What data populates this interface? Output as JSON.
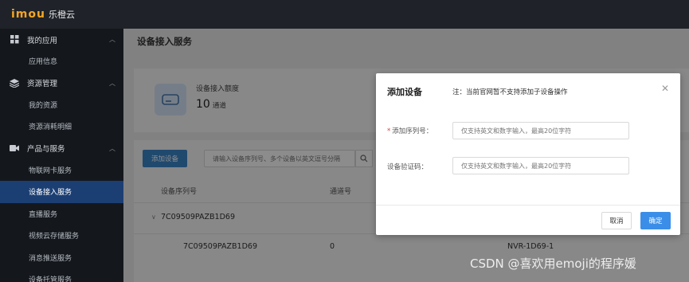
{
  "topbar": {
    "logo": "imou",
    "brand": "乐橙云"
  },
  "sidebar": {
    "groups": [
      {
        "label": "我的应用",
        "items": [
          "应用信息"
        ]
      },
      {
        "label": "资源管理",
        "items": [
          "我的资源",
          "资源消耗明细"
        ]
      },
      {
        "label": "产品与服务",
        "items": [
          "物联网卡服务",
          "设备接入服务",
          "直播服务",
          "视频云存储服务",
          "消息推送服务",
          "设备托管服务"
        ]
      }
    ],
    "active_item": "设备接入服务"
  },
  "main": {
    "title": "设备接入服务",
    "quota": {
      "label": "设备接入额度",
      "value": "10",
      "unit": "通道"
    },
    "add_button": "添加设备",
    "search_placeholder": "请输入设备序列号、多个设备以英文逗号分隔",
    "columns": [
      "设备序列号",
      "通道号"
    ],
    "rows": [
      {
        "serial": "7C09509PAZB1D69"
      },
      {
        "serial": "7C09509PAZB1D69",
        "channel": "0",
        "name": "NVR-1D69-1"
      }
    ]
  },
  "dialog": {
    "title": "添加设备",
    "note": "注：当前官网暂不支持添加子设备操作",
    "serial_label": "添加序列号：",
    "serial_placeholder": "仅支持英文和数字输入，最高20位字符",
    "code_label": "设备验证码：",
    "code_placeholder": "仅支持英文和数字输入，最高20位字符",
    "cancel": "取消",
    "confirm": "确定"
  },
  "watermark": "CSDN @喜欢用emoji的程序媛",
  "colors": {
    "accent": "#3b8ee8",
    "sidebar_bg": "#14181d",
    "active_bg": "#1c3f73",
    "logo": "#f5a623"
  }
}
